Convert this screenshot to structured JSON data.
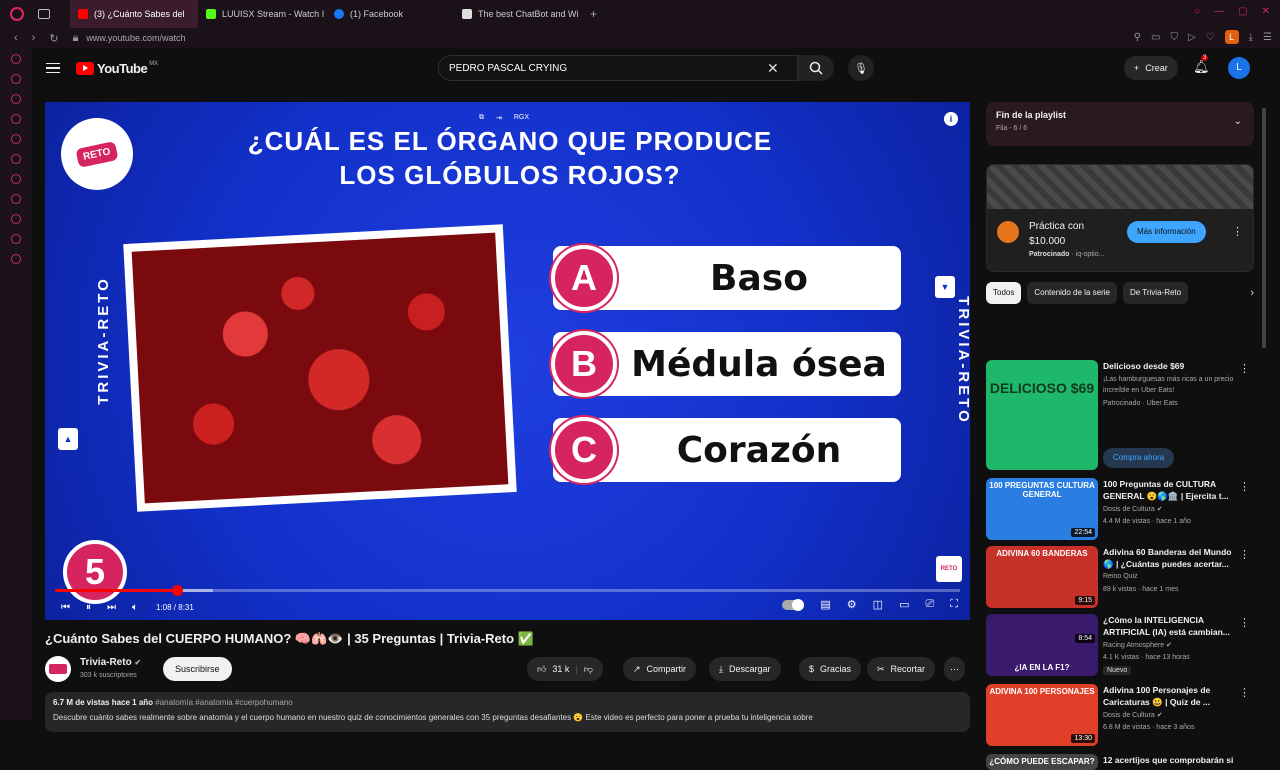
{
  "browser": {
    "tabs": [
      {
        "label": "(3) ¿Cuánto Sabes del",
        "color": "#ff0000"
      },
      {
        "label": "LUUISX Stream - Watch I",
        "color": "#53fc18"
      },
      {
        "label": "(1) Facebook",
        "color": "#1877f2"
      },
      {
        "label": "The best ChatBot and Wi",
        "color": "#dddddd"
      }
    ],
    "tab_add": "+",
    "url": "www.youtube.com/watch",
    "profile_letter": "L"
  },
  "header": {
    "logo_text": "YouTube",
    "country": "MX",
    "search_value": "PEDRO PASCAL CRYING",
    "create_label": "Crear",
    "notif_count": "3",
    "avatar_letter": "L"
  },
  "video": {
    "question": "¿CUÁL ES EL ÓRGANO QUE PRODUCE LOS GLÓBULOS ROJOS?",
    "brand_badge": "RETO",
    "side_text": "TRIVIA-RETO",
    "top_label": "RGX",
    "options": [
      {
        "letter": "A",
        "text": "Baso"
      },
      {
        "letter": "B",
        "text": "Médula ósea"
      },
      {
        "letter": "C",
        "text": "Corazón"
      }
    ],
    "timer": "5",
    "mini_logo": "RETO",
    "time": "1:08 / 8:31",
    "progress": 0.135,
    "buffered": 0.175
  },
  "info": {
    "title": "¿Cuánto Sabes del CUERPO HUMANO? 🧠🫁👁️ | 35 Preguntas | Trivia-Reto ✅",
    "channel": "Trivia-Reto",
    "subs": "303 k suscriptores",
    "subscribe": "Suscribirse",
    "likes": "31 k",
    "share": "Compartir",
    "download": "Descargar",
    "thanks": "Gracias",
    "clip": "Recortar",
    "views": "6.7 M de vistas  hace 1 año",
    "tags": "#anatomía #anatomia #cuerpohumano",
    "desc": "Descubre cuánto sabes realmente sobre anatomía y el cuerpo humano en nuestro quiz de conocimientos generales con 35 preguntas desafiantes 😮 Este video es perfecto para poner a prueba tu inteligencia sobre"
  },
  "sidebar": {
    "playlist_title": "Fin de la playlist",
    "playlist_sub": "Fila - 6 / 6",
    "ad": {
      "line1": "Práctica con",
      "line2": "$10.000",
      "sponsored": "Patrocinado",
      "domain": " · iq-optio...",
      "more": "Más información"
    },
    "chips": [
      "Todos",
      "Contenido de la serie",
      "De Trivia-Reto"
    ],
    "items": [
      {
        "title": "Delicioso desde $69",
        "channel": "¡Las hamburguesas más ricas a un precio increíble en Uber Eats!",
        "meta": "Patrocinado · Uber Eats",
        "caption": "DELICIOSO $69",
        "duration": "",
        "bg": "#1fb86a",
        "buy": "Compra ahora"
      },
      {
        "title": "100 Preguntas de CULTURA GENERAL 😮🌎🏛️ | Ejercita t...",
        "channel": "Dosis de Cultura ✔",
        "meta": "4.4 M de vistas · hace 1 año",
        "caption": "100 PREGUNTAS CULTURA GENERAL",
        "duration": "22:54",
        "bg": "#2a7de1"
      },
      {
        "title": "Adivina 60 Banderas del Mundo 🌎 | ¿Cuántas puedes acertar...",
        "channel": "Reino Quiz",
        "meta": "89 k vistas · hace 1 mes",
        "caption": "ADIVINA 60 BANDERAS",
        "duration": "9:15",
        "bg": "#c8302a"
      },
      {
        "title": "¿Cómo la INTELIGENCIA ARTIFICIAL (IA) está cambian...",
        "channel": "Racing Atmosphere ✔",
        "meta": "4.1 K vistas · hace 13 horas",
        "caption": "¿IA EN LA F1?",
        "duration": "8:54",
        "bg": "#3a1a6a",
        "badge": "Nuevo"
      },
      {
        "title": "Adivina 100 Personajes de Caricaturas 😃 | Quiz de ...",
        "channel": "Dosis de Cultura ✔",
        "meta": "6.8 M de vistas · hace 3 años",
        "caption": "ADIVINA 100 PERSONAJES",
        "duration": "13:30",
        "bg": "#e0402a"
      },
      {
        "title": "12 acertijos que comprobarán si",
        "channel": "",
        "meta": "",
        "caption": "¿CÓMO PUEDE ESCAPAR?",
        "duration": "",
        "bg": "#444444"
      }
    ]
  }
}
